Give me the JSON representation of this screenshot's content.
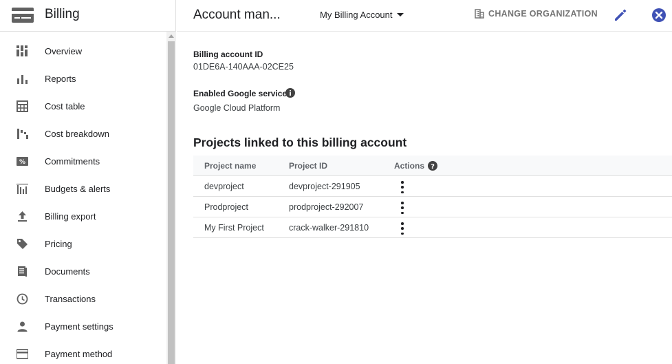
{
  "sidebar": {
    "title": "Billing",
    "items": [
      {
        "label": "Overview",
        "icon": "dashboard-icon"
      },
      {
        "label": "Reports",
        "icon": "bar-chart-icon"
      },
      {
        "label": "Cost table",
        "icon": "table-icon"
      },
      {
        "label": "Cost breakdown",
        "icon": "waterfall-chart-icon"
      },
      {
        "label": "Commitments",
        "icon": "percent-icon"
      },
      {
        "label": "Budgets & alerts",
        "icon": "budget-chart-icon"
      },
      {
        "label": "Billing export",
        "icon": "upload-icon"
      },
      {
        "label": "Pricing",
        "icon": "tag-icon"
      },
      {
        "label": "Documents",
        "icon": "document-icon"
      },
      {
        "label": "Transactions",
        "icon": "clock-icon"
      },
      {
        "label": "Payment settings",
        "icon": "person-icon"
      },
      {
        "label": "Payment method",
        "icon": "credit-card-icon"
      }
    ]
  },
  "topbar": {
    "page_title": "Account man...",
    "account_selector": "My Billing Account",
    "change_org_label": "CHANGE ORGANIZATION"
  },
  "main": {
    "account_id_label": "Billing account ID",
    "account_id_value": "01DE6A-140AAA-02CE25",
    "service_label": "Enabled Google service",
    "service_value": "Google Cloud Platform",
    "section_title": "Projects linked to this billing account",
    "table": {
      "headers": [
        "Project name",
        "Project ID",
        "Actions"
      ],
      "rows": [
        {
          "name": "devproject",
          "id": "devproject-291905"
        },
        {
          "name": "Prodproject",
          "id": "prodproject-292007"
        },
        {
          "name": "My First Project",
          "id": "crack-walker-291810"
        }
      ]
    }
  },
  "colors": {
    "accent": "#3f51b5",
    "text": "#202124",
    "muted": "#5f6368"
  }
}
